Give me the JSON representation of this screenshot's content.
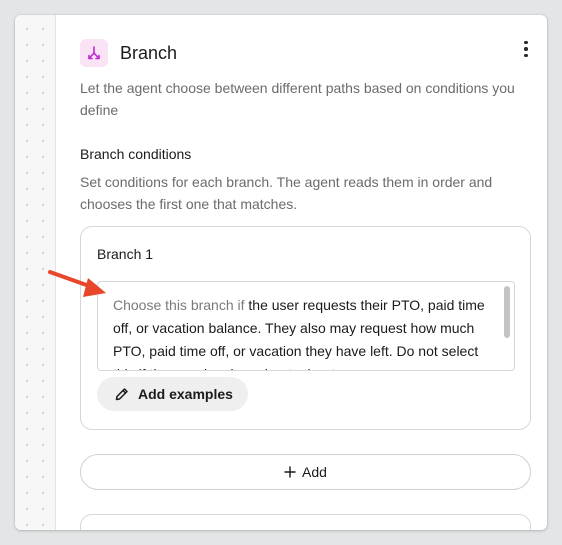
{
  "node": {
    "title": "Branch",
    "description": "Let the agent choose between different paths based on conditions you define",
    "icon": "branch-fork-icon",
    "icon_color": "#c026d3",
    "icon_bg": "#fbe3f6"
  },
  "conditions": {
    "title": "Branch conditions",
    "description": "Set conditions for each branch. The agent reads them in order and chooses the first one that matches."
  },
  "branches": [
    {
      "title": "Branch 1",
      "condition_prefix": "Choose this branch if",
      "condition_text": " the user requests their PTO, paid time off, or vacation balance.  They also may request how much PTO, paid time off, or vacation they have left. Do not select this if the user inquires about other types",
      "add_examples_label": "Add examples"
    }
  ],
  "add_button_label": "Add",
  "annotation": {
    "arrow_color": "#e8472c"
  }
}
